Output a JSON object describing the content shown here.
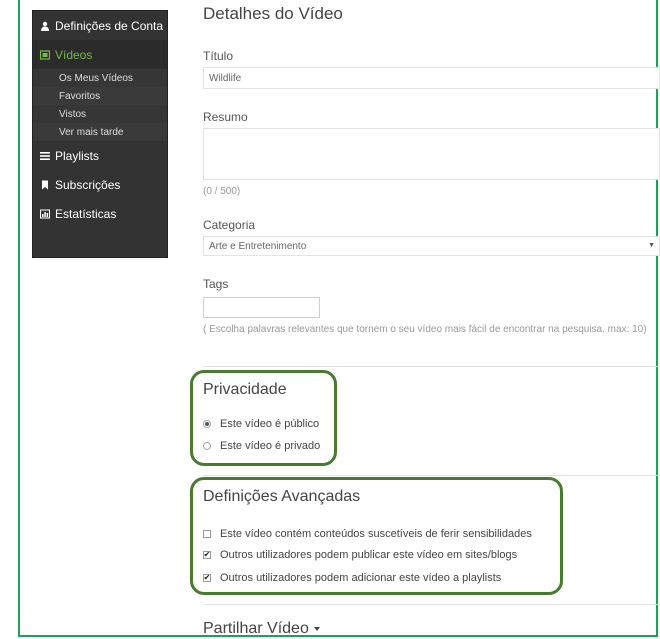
{
  "sidebar": {
    "account": "Definições de Conta",
    "videos": "Vídeos",
    "sub": [
      "Os Meus Vídeos",
      "Favoritos",
      "Vistos",
      "Ver mais tarde"
    ],
    "playlists": "Playlists",
    "subscriptions": "Subscrições",
    "stats": "Estatísticas"
  },
  "details": {
    "title": "Detalhes do Vídeo",
    "title_label": "Título",
    "title_value": "Wildlife",
    "summary_label": "Resumo",
    "summary_value": "",
    "counter": "(0 / 500)",
    "category_label": "Categoria",
    "category_value": "Arte e Entretenimento",
    "tags_label": "Tags",
    "tags_value": "",
    "tags_help": "( Escolha palavras relevantes que tornem o seu vídeo mais fácil de encontrar na pesquisa. max: 10)"
  },
  "privacy": {
    "title": "Privacidade",
    "public": "Este vídeo é público",
    "private": "Este vídeo é privado",
    "selected": "public"
  },
  "advanced": {
    "title": "Definições Avançadas",
    "options": [
      {
        "label": "Este vídeo contém conteúdos suscetíveis de ferir sensibilidades",
        "checked": false
      },
      {
        "label": "Outros utilizadores podem publicar este vídeo em sites/blogs",
        "checked": true
      },
      {
        "label": "Outros utilizadores podem adicionar este vídeo a playlists",
        "checked": true
      }
    ]
  },
  "share": {
    "title": "Partilhar Vídeo"
  },
  "colors": {
    "accent_green": "#76b93f",
    "highlight_border": "#4a7a32",
    "sidebar_bg": "#333333"
  }
}
